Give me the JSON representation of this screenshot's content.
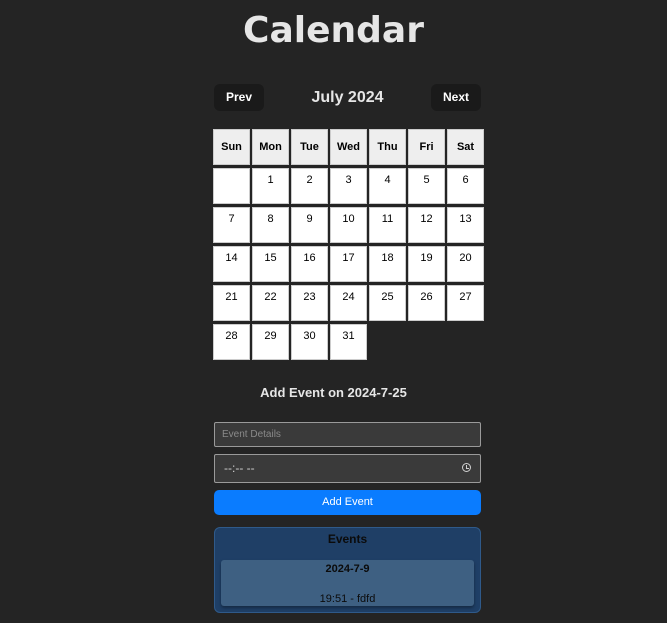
{
  "app": {
    "title": "Calendar"
  },
  "nav": {
    "prev_label": "Prev",
    "next_label": "Next",
    "month_label": "July 2024"
  },
  "weekdays": [
    "Sun",
    "Mon",
    "Tue",
    "Wed",
    "Thu",
    "Fri",
    "Sat"
  ],
  "calendar": {
    "leading_blank_days": 1,
    "days_in_month": 31,
    "selected_date": "2024-7-25"
  },
  "add_event": {
    "heading": "Add Event on 2024-7-25",
    "details_placeholder": "Event Details",
    "time_value": "--:--  --",
    "button_label": "Add Event"
  },
  "events": {
    "title": "Events",
    "items": [
      {
        "date": "2024-7-9",
        "text": "19:51 - fdfd"
      }
    ]
  },
  "colors": {
    "accent": "#0a7cff",
    "background": "#242424",
    "events_panel": "#1f3f66"
  }
}
